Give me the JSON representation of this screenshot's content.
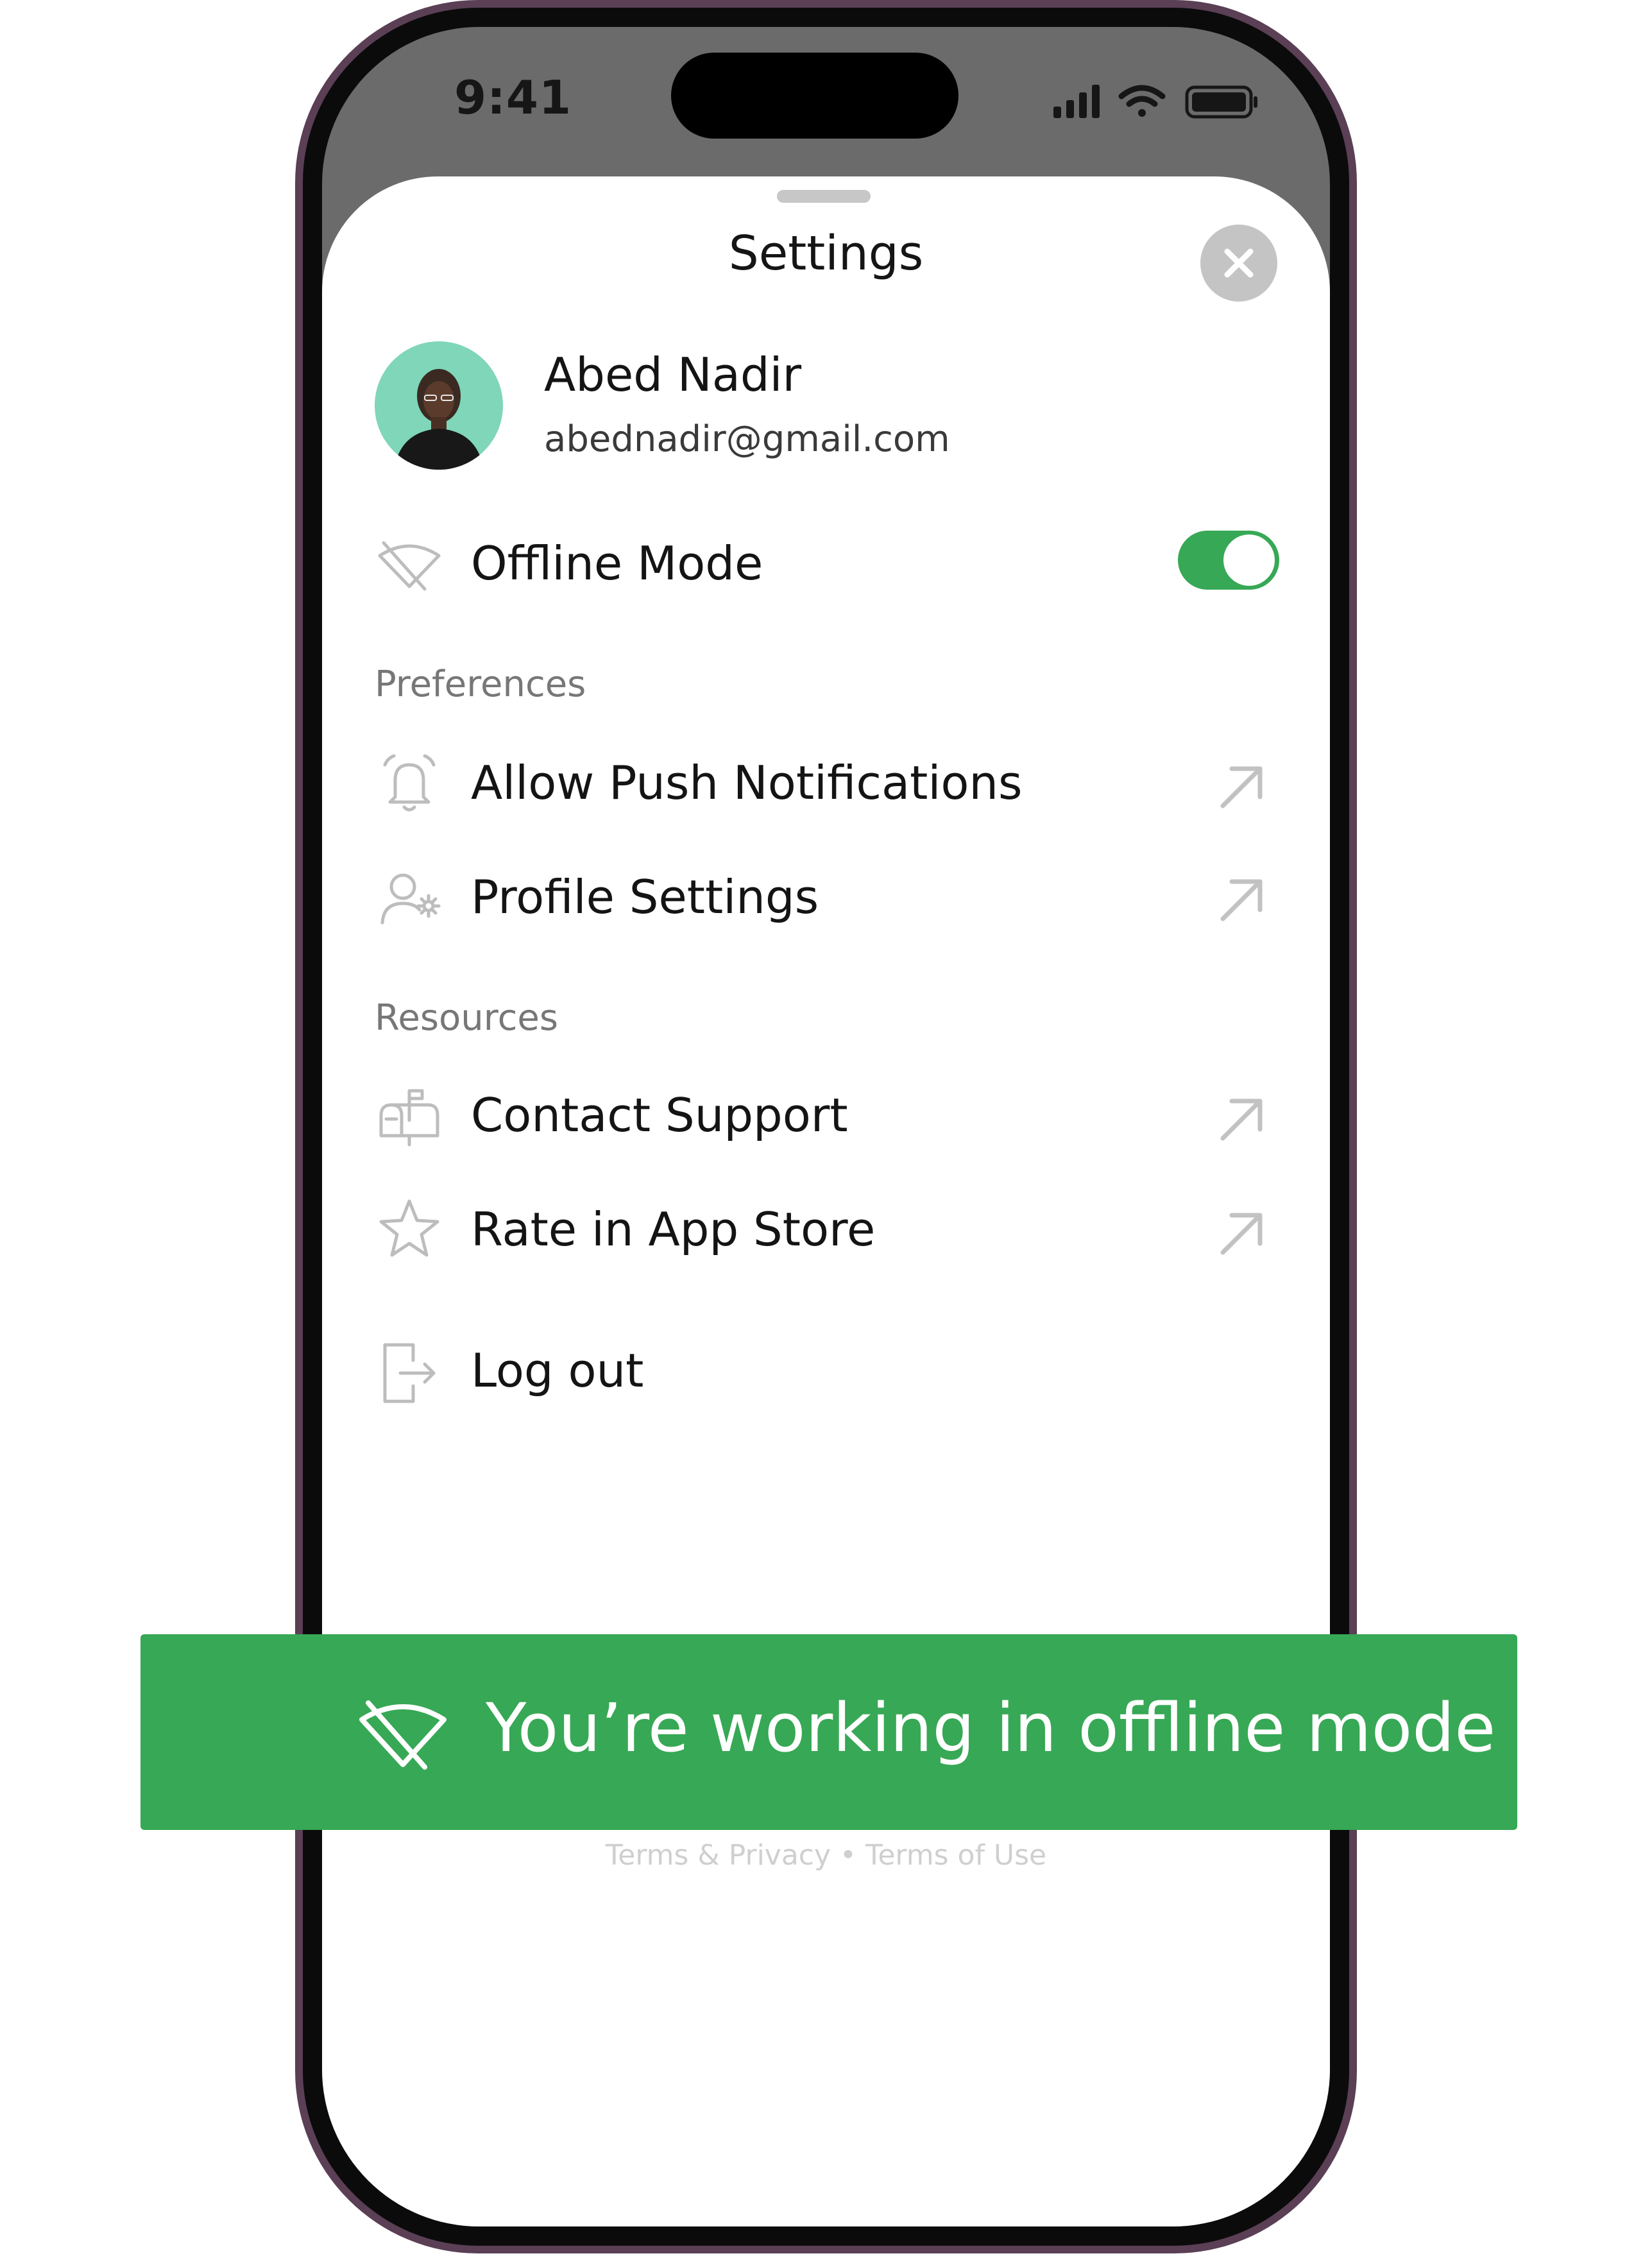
{
  "status_bar": {
    "time": "9:41"
  },
  "sheet": {
    "title": "Settings"
  },
  "profile": {
    "name": "Abed Nadir",
    "email": "abednadir@gmail.com"
  },
  "offline_mode": {
    "label": "Offline Mode",
    "enabled": true
  },
  "sections": {
    "preferences": {
      "title": "Preferences",
      "items": [
        {
          "label": "Allow Push Notifications",
          "icon": "bell-icon"
        },
        {
          "label": "Profile Settings",
          "icon": "user-gear-icon"
        }
      ]
    },
    "resources": {
      "title": "Resources",
      "items": [
        {
          "label": "Contact Support",
          "icon": "mailbox-icon"
        },
        {
          "label": "Rate in App Store",
          "icon": "star-icon"
        }
      ]
    }
  },
  "logout": {
    "label": "Log out",
    "icon": "logout-icon"
  },
  "footer": {
    "links": "Terms & Privacy • Terms of Use"
  },
  "banner": {
    "text": "You’re working in offline mode",
    "icon": "wifi-off-icon"
  },
  "colors": {
    "accent": "#37a855",
    "frame": "#5a3f55",
    "icon_gray": "#bdbdbd"
  }
}
